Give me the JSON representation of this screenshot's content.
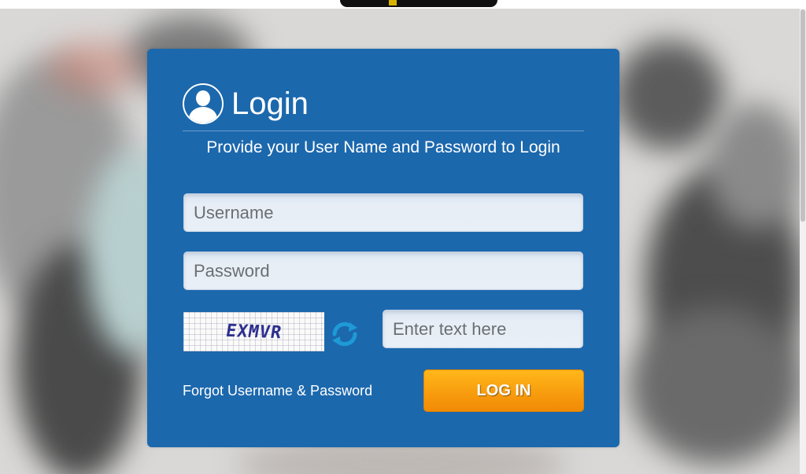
{
  "login": {
    "title": "Login",
    "subtitle": "Provide your User Name and Password to Login",
    "username_placeholder": "Username",
    "password_placeholder": "Password",
    "captcha_code": "EXMVR",
    "captcha_input_placeholder": "Enter text here",
    "forgot_link": "Forgot Username & Password",
    "login_button": "LOG IN"
  },
  "colors": {
    "panel": "#1c68ad",
    "button": "#f79b0d",
    "field": "#e8eef6"
  },
  "icons": {
    "user": "user-icon",
    "refresh": "refresh-icon"
  }
}
